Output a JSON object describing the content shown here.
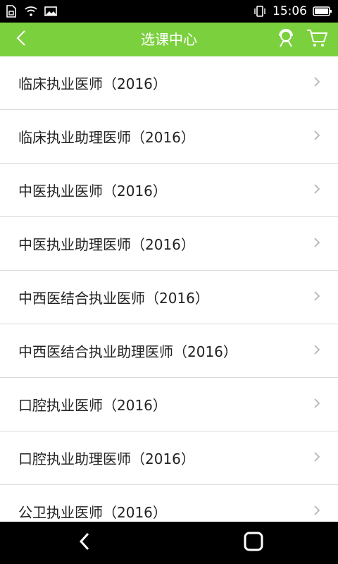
{
  "status_bar": {
    "time": "15:06",
    "icons": [
      "sim-icon",
      "wifi-icon",
      "image-icon",
      "vibrate-icon",
      "battery-icon"
    ]
  },
  "app_bar": {
    "title": "选课中心",
    "background": "#7bd03e",
    "icons": [
      "back-icon",
      "customer-service-icon",
      "cart-icon"
    ]
  },
  "list": {
    "items": [
      {
        "label": "临床执业医师（2016）"
      },
      {
        "label": "临床执业助理医师（2016）"
      },
      {
        "label": "中医执业医师（2016）"
      },
      {
        "label": "中医执业助理医师（2016）"
      },
      {
        "label": "中西医结合执业医师（2016）"
      },
      {
        "label": "中西医结合执业助理医师（2016）"
      },
      {
        "label": "口腔执业医师（2016）"
      },
      {
        "label": "口腔执业助理医师（2016）"
      },
      {
        "label": "公卫执业医师（2016）"
      }
    ]
  },
  "nav_bar": {
    "icons": [
      "nav-back-icon",
      "nav-home-icon"
    ]
  }
}
